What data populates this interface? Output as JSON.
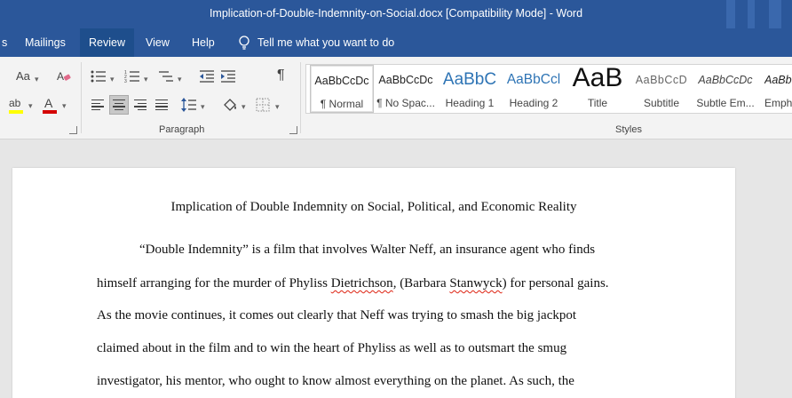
{
  "window": {
    "title": "Implication-of-Double-Indemnity-on-Social.docx [Compatibility Mode]  -  Word"
  },
  "tabs": [
    {
      "label": "s"
    },
    {
      "label": "Mailings"
    },
    {
      "label": "Review"
    },
    {
      "label": "View"
    },
    {
      "label": "Help"
    }
  ],
  "tell_me": {
    "label": "Tell me what you want to do",
    "icon": "lightbulb-icon"
  },
  "ribbon": {
    "font_case_label": "Aa",
    "font_color_label": "A",
    "highlight_label": "ab",
    "paragraph_mark": "¶",
    "paragraph_group_label": "Paragraph",
    "styles_group_label": "Styles",
    "highlight_color": "#ffff00",
    "font_color": "#d40000"
  },
  "styles": [
    {
      "preview": "AaBbCcDc",
      "name": "¶ Normal"
    },
    {
      "preview": "AaBbCcDc",
      "name": "¶ No Spac..."
    },
    {
      "preview": "AaBbC",
      "name": "Heading 1"
    },
    {
      "preview": "AaBbCcl",
      "name": "Heading 2"
    },
    {
      "preview": "AaB",
      "name": "Title"
    },
    {
      "preview": "AaBbCcD",
      "name": "Subtitle"
    },
    {
      "preview": "AaBbCcDc",
      "name": "Subtle Em..."
    },
    {
      "preview": "AaBb",
      "name": "Emph"
    }
  ],
  "document": {
    "title": "Implication of Double Indemnity on Social, Political, and Economic Reality",
    "line1": "“Double Indemnity” is a film that involves Walter Neff, an insurance agent who finds",
    "line2_a": "himself arranging for the murder of Phyliss ",
    "line2_b": "Dietrichson",
    "line2_c": ", (Barbara ",
    "line2_d": "Stanwyck",
    "line2_e": ") for personal gains.",
    "line3": "As the movie continues, it comes out clearly that Neff was trying to smash the big jackpot",
    "line4": "claimed about in the film and to win the heart of Phyliss as well as to outsmart the smug",
    "line5": "investigator, his mentor, who ought to know almost everything on the planet.  As such, the"
  }
}
